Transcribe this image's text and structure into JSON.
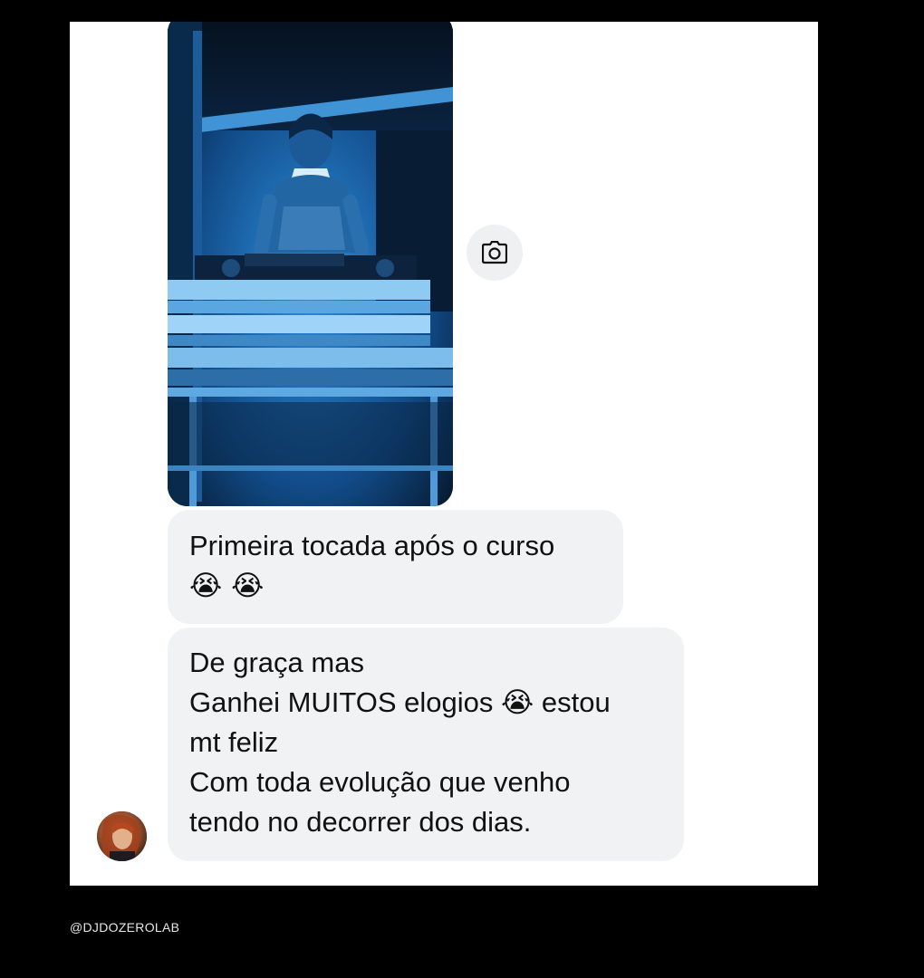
{
  "conversation": {
    "media": {
      "type": "photo",
      "icon": "camera-icon"
    },
    "messages": [
      {
        "lines": [
          "Primeira tocada após o curso",
          "😭 😭"
        ]
      },
      {
        "lines": [
          "De graça mas",
          "Ganhei MUITOS elogios 😭 estou",
          "mt feliz",
          "Com toda evolução que venho",
          "tendo no decorrer dos dias."
        ]
      }
    ],
    "sender_avatar": "avatar"
  },
  "footer": {
    "handle": "@DJDOZEROLAB"
  },
  "colors": {
    "page_background": "#000000",
    "chat_background": "#ffffff",
    "bubble_background": "#f1f2f4",
    "text": "#111111",
    "media_tint": "#1f7fd0"
  }
}
